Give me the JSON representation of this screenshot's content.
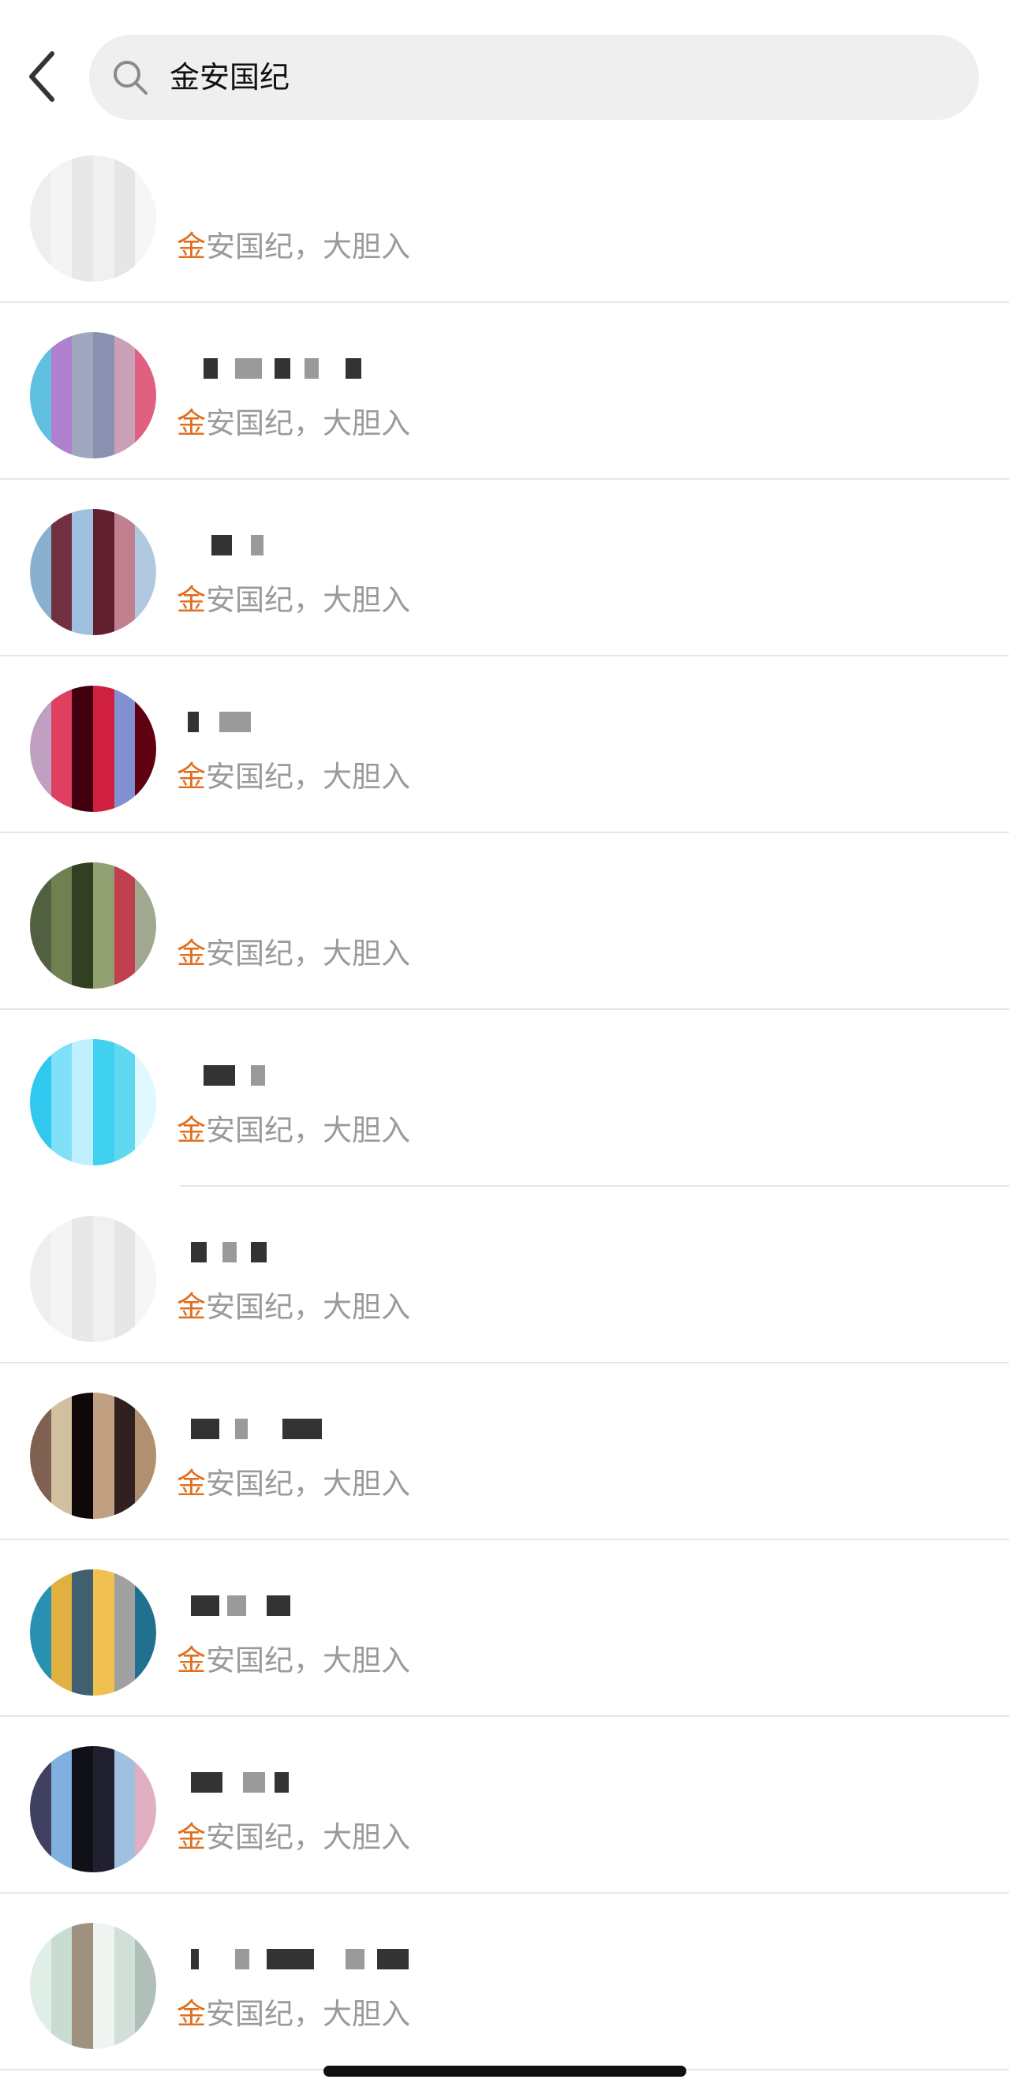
{
  "search": {
    "query": "金安国纪"
  },
  "results": [
    {
      "highlight": "金",
      "rest": "安国纪，大胆入"
    },
    {
      "highlight": "金",
      "rest": "安国纪，大胆入"
    },
    {
      "highlight": "金",
      "rest": "安国纪，大胆入"
    },
    {
      "highlight": "金",
      "rest": "安国纪，大胆入"
    },
    {
      "highlight": "金",
      "rest": "安国纪，大胆入"
    },
    {
      "highlight": "金",
      "rest": "安国纪，大胆入"
    },
    {
      "highlight": "金",
      "rest": "安国纪，大胆入"
    },
    {
      "highlight": "金",
      "rest": "安国纪，大胆入"
    },
    {
      "highlight": "金",
      "rest": "安国纪，大胆入"
    },
    {
      "highlight": "金",
      "rest": "安国纪，大胆入"
    },
    {
      "highlight": "金",
      "rest": "安国纪，大胆入"
    }
  ],
  "colors": {
    "highlight": "#e07020",
    "snippet": "#9a9a9a",
    "search_bg": "#efefef"
  },
  "icons": {
    "back": "chevron-left-icon",
    "search": "search-icon"
  }
}
